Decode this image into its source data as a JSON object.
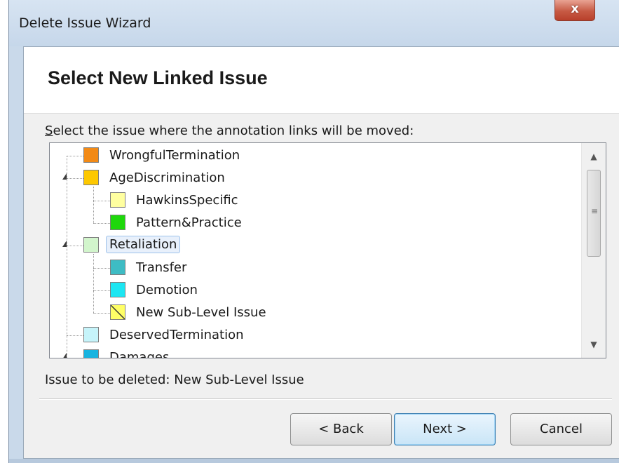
{
  "window": {
    "title": "Delete Issue Wizard",
    "close_glyph": "x"
  },
  "page": {
    "title": "Select New Linked Issue",
    "prompt_accel": "S",
    "prompt_rest": "elect the issue where the annotation links will be moved:"
  },
  "tree": {
    "items": [
      {
        "label": "WrongfulTermination",
        "color": "#F28A16",
        "level": 0,
        "expanded": null
      },
      {
        "label": "AgeDiscrimination",
        "color": "#FDC800",
        "level": 0,
        "expanded": true
      },
      {
        "label": "HawkinsSpecific",
        "color": "#FFFFA0",
        "level": 1,
        "expanded": null
      },
      {
        "label": "Pattern&Practice",
        "color": "#1ED80B",
        "level": 1,
        "expanded": null
      },
      {
        "label": "Retaliation",
        "color": "#D2F5CC",
        "level": 0,
        "expanded": true,
        "selected": true
      },
      {
        "label": "Transfer",
        "color": "#3EBCC4",
        "level": 1,
        "expanded": null
      },
      {
        "label": "Demotion",
        "color": "#1CE6F2",
        "level": 1,
        "expanded": null
      },
      {
        "label": "New Sub-Level Issue",
        "color": "#FFFF66",
        "level": 1,
        "expanded": null,
        "hatched": true
      },
      {
        "label": "DeservedTermination",
        "color": "#C6F4FA",
        "level": 0,
        "expanded": null
      },
      {
        "label": "Damages",
        "color": "#18B4E0",
        "level": 0,
        "expanded": true
      }
    ],
    "scroll_up": "▲",
    "scroll_down": "▼",
    "grip": "≡"
  },
  "status": {
    "text": "Issue to be deleted: New Sub-Level Issue"
  },
  "buttons": {
    "back": "< Back",
    "next": "Next >",
    "cancel": "Cancel"
  }
}
